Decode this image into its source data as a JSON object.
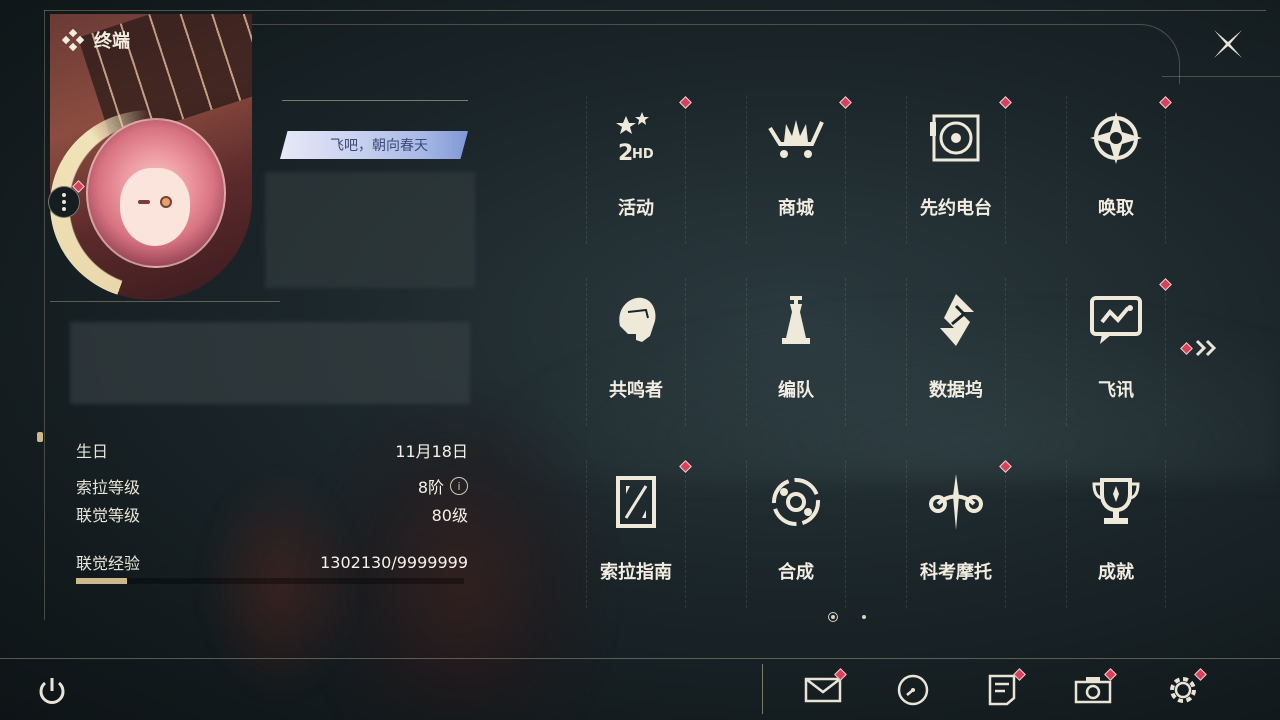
{
  "window": {
    "title": "终端"
  },
  "profile": {
    "signature": "飞吧，朝向春天",
    "stats": [
      {
        "label": "生日",
        "value": "11月18日"
      },
      {
        "label": "索拉等级",
        "value": "8阶",
        "info_icon": "info-icon"
      },
      {
        "label": "联觉等级",
        "value": "80级"
      }
    ],
    "exp": {
      "label": "联觉经验",
      "value": "1302130/9999999",
      "progress": 0.1302
    }
  },
  "menu": {
    "tiles": [
      {
        "label": "活动",
        "icon": "event-2hd-icon",
        "badge": true
      },
      {
        "label": "商城",
        "icon": "shop-cart-icon",
        "badge": true
      },
      {
        "label": "先约电台",
        "icon": "radio-record-icon",
        "badge": true
      },
      {
        "label": "唤取",
        "icon": "summon-compass-icon",
        "badge": true
      },
      {
        "label": "共鸣者",
        "icon": "resonator-head-icon",
        "badge": false
      },
      {
        "label": "编队",
        "icon": "team-chess-icon",
        "badge": false
      },
      {
        "label": "数据坞",
        "icon": "data-bank-icon",
        "badge": false
      },
      {
        "label": "飞讯",
        "icon": "message-chat-icon",
        "badge": true
      },
      {
        "label": "索拉指南",
        "icon": "guide-book-icon",
        "badge": true
      },
      {
        "label": "合成",
        "icon": "synthesis-icon",
        "badge": false
      },
      {
        "label": "科考摩托",
        "icon": "motorcycle-icon",
        "badge": true
      },
      {
        "label": "成就",
        "icon": "trophy-icon",
        "badge": false
      }
    ],
    "pagination": {
      "current": 1,
      "total": 2
    }
  },
  "bottom_bar": {
    "buttons": [
      "mail-icon",
      "clock-icon",
      "notice-icon",
      "camera-icon",
      "settings-icon"
    ]
  },
  "colors": {
    "accent_gold": "#cdb98a",
    "badge_red": "#d7425a",
    "text_light": "#f2ede0"
  }
}
